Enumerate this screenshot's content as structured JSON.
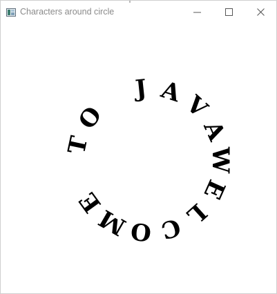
{
  "window": {
    "title": "Characters around circle",
    "icon": "java-app-window-icon",
    "controls": {
      "minimize_icon": "minimize-icon",
      "maximize_icon": "maximize-icon",
      "close_icon": "close-icon"
    }
  },
  "canvas": {
    "text": "WELCOME TO JAVA",
    "characters": [
      "W",
      "E",
      "L",
      "C",
      "O",
      "M",
      "E",
      " ",
      "T",
      "O",
      " ",
      "J",
      "A",
      "V",
      "A"
    ],
    "text_color": "#000000",
    "background_color": "#ffffff"
  }
}
